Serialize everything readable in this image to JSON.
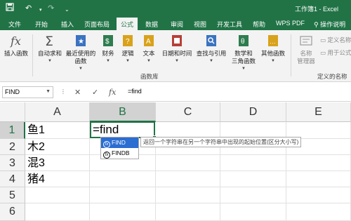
{
  "window": {
    "title": "工作簿1 - Excel"
  },
  "quick_access": {
    "save_icon": "save-icon",
    "undo_icon": "undo-icon",
    "redo_icon": "redo-icon",
    "customize_icon": "chevron-down-icon"
  },
  "tabs": [
    "文件",
    "开始",
    "插入",
    "页面布局",
    "公式",
    "数据",
    "审阅",
    "视图",
    "开发工具",
    "帮助",
    "WPS PDF",
    "操作说明"
  ],
  "active_tab": "公式",
  "ribbon": {
    "insert_function": {
      "line1": "插入函数",
      "line2": ""
    },
    "autosum": {
      "line1": "自动求和",
      "line2": ""
    },
    "recent": {
      "line1": "最近使用的",
      "line2": "函数"
    },
    "finance": {
      "line1": "财务",
      "line2": ""
    },
    "logical": {
      "line1": "逻辑",
      "line2": ""
    },
    "text": {
      "line1": "文本",
      "line2": ""
    },
    "datetime": {
      "line1": "日期和时间",
      "line2": ""
    },
    "lookup": {
      "line1": "查找与引用",
      "line2": ""
    },
    "math": {
      "line1": "数学和",
      "line2": "三角函数"
    },
    "other": {
      "line1": "其他函数",
      "line2": ""
    },
    "group_label": "函数库",
    "name_manager": {
      "line1": "名称",
      "line2": "管理器"
    },
    "define_name": "定义名称",
    "use_in_formula": "用于公式",
    "defined_names_group": "定义的名称"
  },
  "formula_bar": {
    "name_box": "FIND",
    "cancel": "✕",
    "enter": "✓",
    "fx": "fx",
    "content": "=find"
  },
  "columns": [
    "A",
    "B",
    "C",
    "D",
    "E"
  ],
  "rows": [
    "1",
    "2",
    "3",
    "4",
    "5",
    "6"
  ],
  "cells": {
    "A1": "鱼1",
    "A2": "木2",
    "A3": "混3",
    "A4": "猪4"
  },
  "active_cell": {
    "ref": "B1",
    "value": "=find"
  },
  "autocomplete": {
    "items": [
      {
        "name": "FIND",
        "selected": true
      },
      {
        "name": "FINDB",
        "selected": false
      }
    ],
    "tooltip": "返回一个字符串在另一个字符串中出现的起始位置(区分大小写)"
  },
  "colors": {
    "excel_green": "#217346",
    "ribbon_bg": "#f3f3f3",
    "selection_blue": "#2b6dd1"
  }
}
